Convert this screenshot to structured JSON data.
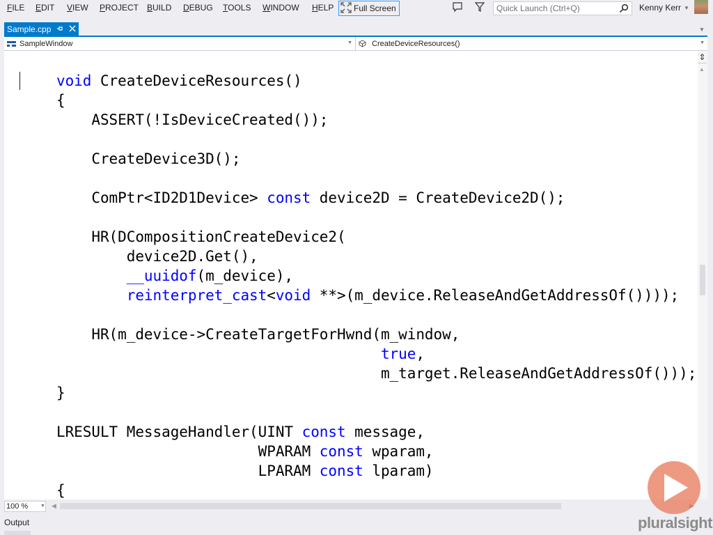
{
  "menubar": {
    "items": [
      {
        "label": "FILE",
        "accel": "F"
      },
      {
        "label": "EDIT",
        "accel": "E"
      },
      {
        "label": "VIEW",
        "accel": "V"
      },
      {
        "label": "PROJECT",
        "accel": "P"
      },
      {
        "label": "BUILD",
        "accel": "B"
      },
      {
        "label": "DEBUG",
        "accel": "D"
      },
      {
        "label": "TOOLS",
        "accel": "T"
      },
      {
        "label": "WINDOW",
        "accel": "W"
      },
      {
        "label": "HELP",
        "accel": "H"
      }
    ],
    "full_screen_label": "Full Screen",
    "quick_launch_placeholder": "Quick Launch (Ctrl+Q)",
    "user_name": "Kenny Kerr"
  },
  "tabs": [
    {
      "label": "Sample.cpp",
      "active": true
    }
  ],
  "navbar": {
    "scope": "SampleWindow",
    "member": "CreateDeviceResources()"
  },
  "editor": {
    "lines": [
      [
        {
          "t": "void",
          "k": 1
        },
        {
          "t": " CreateDeviceResources()"
        }
      ],
      [
        {
          "t": "{"
        }
      ],
      [
        {
          "t": "    ASSERT(!IsDeviceCreated());"
        }
      ],
      [
        {
          "t": ""
        }
      ],
      [
        {
          "t": "    CreateDevice3D();"
        }
      ],
      [
        {
          "t": ""
        }
      ],
      [
        {
          "t": "    ComPtr<ID2D1Device> "
        },
        {
          "t": "const",
          "k": 1
        },
        {
          "t": " device2D = CreateDevice2D();"
        }
      ],
      [
        {
          "t": ""
        }
      ],
      [
        {
          "t": "    HR(DCompositionCreateDevice2("
        }
      ],
      [
        {
          "t": "        device2D.Get(),"
        }
      ],
      [
        {
          "t": "        "
        },
        {
          "t": "__uuidof",
          "k": 1
        },
        {
          "t": "(m_device),"
        }
      ],
      [
        {
          "t": "        "
        },
        {
          "t": "reinterpret_cast",
          "k": 1
        },
        {
          "t": "<"
        },
        {
          "t": "void",
          "k": 1
        },
        {
          "t": " **>(m_device.ReleaseAndGetAddressOf())));"
        }
      ],
      [
        {
          "t": ""
        }
      ],
      [
        {
          "t": "    HR(m_device->CreateTargetForHwnd(m_window,"
        }
      ],
      [
        {
          "t": "                                     "
        },
        {
          "t": "true",
          "k": 1
        },
        {
          "t": ","
        }
      ],
      [
        {
          "t": "                                     m_target.ReleaseAndGetAddressOf()));"
        }
      ],
      [
        {
          "t": "}"
        }
      ],
      [
        {
          "t": ""
        }
      ],
      [
        {
          "t": "LRESULT MessageHandler(UINT "
        },
        {
          "t": "const",
          "k": 1
        },
        {
          "t": " message,"
        }
      ],
      [
        {
          "t": "                       WPARAM "
        },
        {
          "t": "const",
          "k": 1
        },
        {
          "t": " wparam,"
        }
      ],
      [
        {
          "t": "                       LPARAM "
        },
        {
          "t": "const",
          "k": 1
        },
        {
          "t": " lparam)"
        }
      ],
      [
        {
          "t": "{"
        }
      ]
    ],
    "keyword_color": "#0000ff",
    "text_color": "#000000"
  },
  "status": {
    "zoom_level": "100 %"
  },
  "output_panel": {
    "title": "Output"
  },
  "watermark": {
    "brand": "pluralsight",
    "brand_color": "#e8785a"
  }
}
